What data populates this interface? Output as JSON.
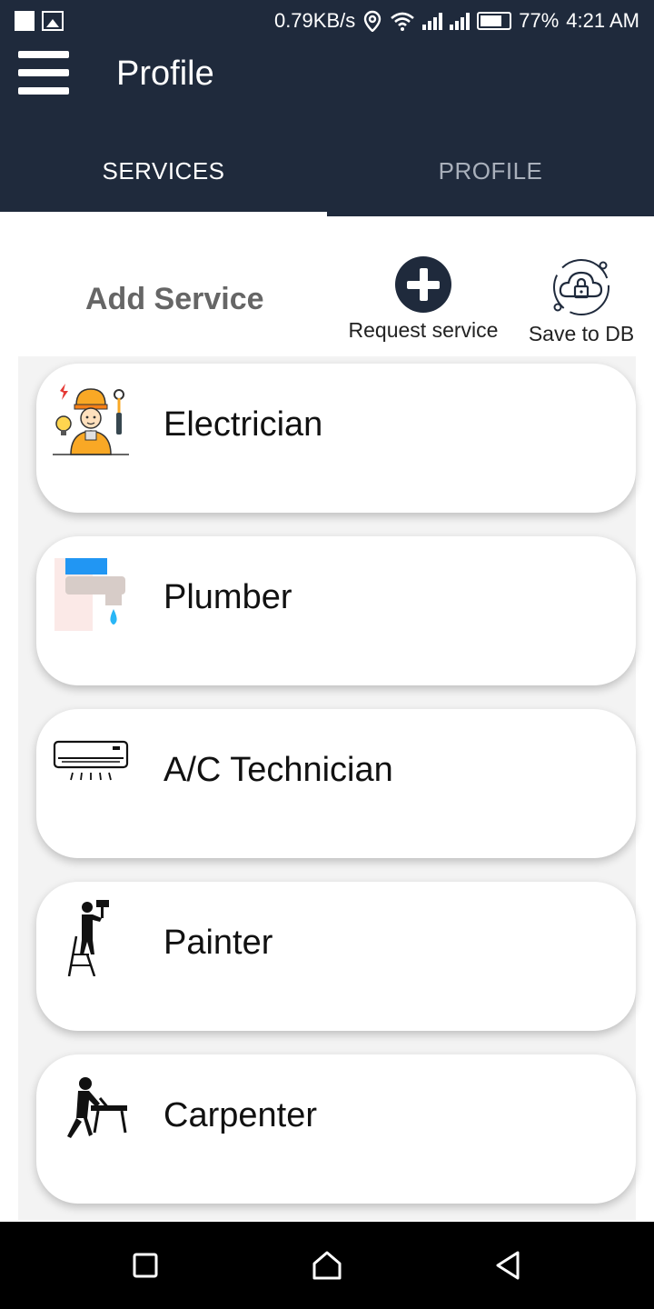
{
  "status_bar": {
    "speed": "0.79KB/s",
    "battery": "77%",
    "battery_level": 0.77,
    "time": "4:21 AM"
  },
  "app_bar": {
    "title": "Profile"
  },
  "tabs": [
    {
      "label": "SERVICES",
      "active": true
    },
    {
      "label": "PROFILE",
      "active": false
    }
  ],
  "content": {
    "heading": "Add Service",
    "actions": {
      "request_label": "Request service",
      "save_label": "Save to DB"
    },
    "services": [
      {
        "label": "Electrician",
        "icon": "electrician-icon"
      },
      {
        "label": "Plumber",
        "icon": "faucet-icon"
      },
      {
        "label": "A/C Technician",
        "icon": "air-conditioner-icon"
      },
      {
        "label": "Painter",
        "icon": "painter-icon"
      },
      {
        "label": "Carpenter",
        "icon": "carpenter-icon"
      }
    ]
  },
  "colors": {
    "header_bg": "#1f2a3c",
    "accent": "#1f2a3c",
    "inactive_tab": "#a9b0bb"
  }
}
